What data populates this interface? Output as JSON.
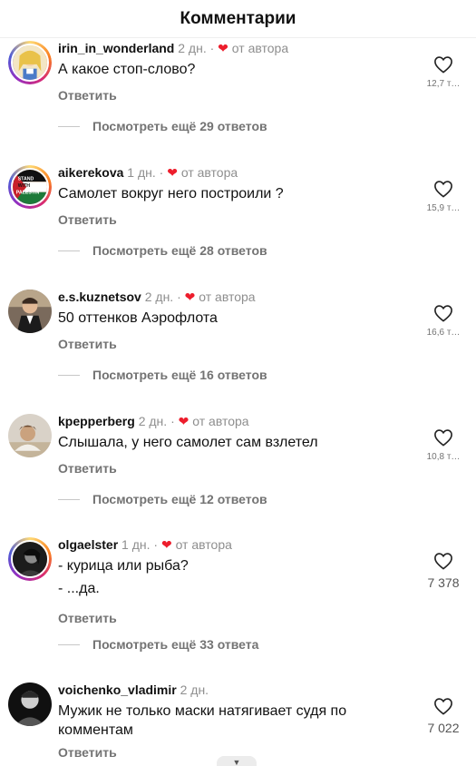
{
  "header": {
    "title": "Комментарии"
  },
  "comments": [
    {
      "username": "irin_in_wonderland",
      "time": "2 дн.",
      "sep": "·",
      "heart": "❤",
      "author_like": "от автора",
      "text": "А какое стоп-слово?",
      "reply": "Ответить",
      "likes": "12,7 т…",
      "more": "Посмотреть ещё 29 ответов"
    },
    {
      "username": "aikerekova",
      "time": "1 дн.",
      "sep": "·",
      "heart": "❤",
      "author_like": "от автора",
      "text": "Самолет вокруг него построили ?",
      "reply": "Ответить",
      "likes": "15,9 т…",
      "more": "Посмотреть ещё 28 ответов"
    },
    {
      "username": "e.s.kuznetsov",
      "time": "2 дн.",
      "sep": "·",
      "heart": "❤",
      "author_like": "от автора",
      "text": "50 оттенков Аэрофлота",
      "reply": "Ответить",
      "likes": "16,6 т…",
      "more": "Посмотреть ещё 16 ответов"
    },
    {
      "username": "kpepperberg",
      "time": "2 дн.",
      "sep": "·",
      "heart": "❤",
      "author_like": "от автора",
      "text": "Слышала, у него самолет сам взлетел",
      "reply": "Ответить",
      "likes": "10,8 т…",
      "more": "Посмотреть ещё 12 ответов"
    },
    {
      "username": "olgaelster",
      "time": "1 дн.",
      "sep": "·",
      "heart": "❤",
      "author_like": "от автора",
      "text_line1": "- курица или рыба?",
      "text_line2": "- ...да.",
      "reply": "Ответить",
      "likes": "7 378",
      "more": "Посмотреть ещё 33 ответа"
    },
    {
      "username": "voichenko_vladimir",
      "time": "2 дн.",
      "text": "Мужик не только  маски натягивает судя по комментам",
      "reply": "Ответить",
      "likes": "7 022"
    }
  ],
  "avatar_badge": {
    "line1": "STAND",
    "line2": "WITH",
    "line3": "PALESTIN"
  },
  "scroll_chevron": "▼"
}
